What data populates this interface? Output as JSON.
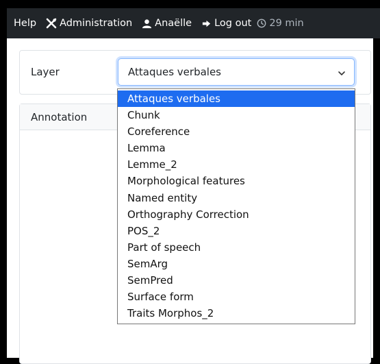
{
  "navbar": {
    "help": "Help",
    "administration": "Administration",
    "user": "Anaëlle",
    "logout": "Log out",
    "timer": "29 min"
  },
  "layer": {
    "label": "Layer",
    "selected": "Attaques verbales",
    "options": [
      "Attaques verbales",
      "Chunk",
      "Coreference",
      "Lemma",
      "Lemme_2",
      "Morphological features",
      "Named entity",
      "Orthography Correction",
      "POS_2",
      "Part of speech",
      "SemArg",
      "SemPred",
      "Surface form",
      "Traits Morphos_2"
    ]
  },
  "annotation": {
    "title": "Annotation"
  },
  "colors": {
    "navbar_bg": "#212529",
    "selected_option": "#1e6cf0",
    "focus_border": "#86b7fe"
  }
}
